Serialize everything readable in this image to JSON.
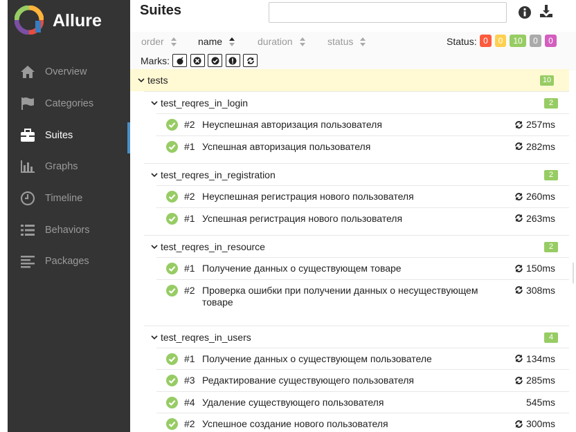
{
  "app": {
    "name": "Allure"
  },
  "nav": [
    {
      "label": "Overview",
      "icon": "home-icon"
    },
    {
      "label": "Categories",
      "icon": "flag-icon"
    },
    {
      "label": "Suites",
      "icon": "briefcase-icon",
      "active": true
    },
    {
      "label": "Graphs",
      "icon": "bar-chart-icon"
    },
    {
      "label": "Timeline",
      "icon": "clock-icon"
    },
    {
      "label": "Behaviors",
      "icon": "list-icon"
    },
    {
      "label": "Packages",
      "icon": "align-left-icon"
    }
  ],
  "header": {
    "title": "Suites",
    "search_value": ""
  },
  "sort": {
    "order": "order",
    "name": "name",
    "duration": "duration",
    "status": "status",
    "active": "name"
  },
  "status_bar": {
    "label": "Status:",
    "counts": [
      {
        "value": "0",
        "color": "#fd5a3e"
      },
      {
        "value": "0",
        "color": "#ffd050"
      },
      {
        "value": "10",
        "color": "#97cc64"
      },
      {
        "value": "0",
        "color": "#aaaaaa"
      },
      {
        "value": "0",
        "color": "#d35ebe"
      }
    ]
  },
  "marks": {
    "label": "Marks:",
    "items": [
      "flaky-icon",
      "new-failed-icon",
      "new-passed-icon",
      "new-broken-icon",
      "retries-icon"
    ]
  },
  "tree": {
    "root": {
      "name": "tests",
      "count": "10"
    },
    "groups": [
      {
        "name": "test_reqres_in_login",
        "count": "2",
        "tests": [
          {
            "num": "#2",
            "name": "Неуспешная авторизация пользователя",
            "duration": "257ms",
            "retry": true
          },
          {
            "num": "#1",
            "name": "Успешная авторизация пользователя",
            "duration": "282ms",
            "retry": true
          }
        ]
      },
      {
        "name": "test_reqres_in_registration",
        "count": "2",
        "tests": [
          {
            "num": "#2",
            "name": "Неуспешная регистрация нового пользователя",
            "duration": "260ms",
            "retry": true
          },
          {
            "num": "#1",
            "name": "Успешная регистрация нового пользователя",
            "duration": "263ms",
            "retry": true
          }
        ]
      },
      {
        "name": "test_reqres_in_resource",
        "count": "2",
        "tests": [
          {
            "num": "#1",
            "name": "Получение данных о существующем товаре",
            "duration": "150ms",
            "retry": true
          },
          {
            "num": "#2",
            "name": "Проверка ошибки при получении данных о несуществующем товаре",
            "duration": "308ms",
            "retry": true
          }
        ]
      },
      {
        "name": "test_reqres_in_users",
        "count": "4",
        "tests": [
          {
            "num": "#1",
            "name": "Получение данных о существующем пользователе",
            "duration": "134ms",
            "retry": true
          },
          {
            "num": "#3",
            "name": "Редактирование существующего пользователя",
            "duration": "285ms",
            "retry": true
          },
          {
            "num": "#4",
            "name": "Удаление существующего пользователя",
            "duration": "545ms",
            "retry": false
          },
          {
            "num": "#2",
            "name": "Успешное создание нового пользователя",
            "duration": "300ms",
            "retry": true
          }
        ]
      }
    ]
  }
}
